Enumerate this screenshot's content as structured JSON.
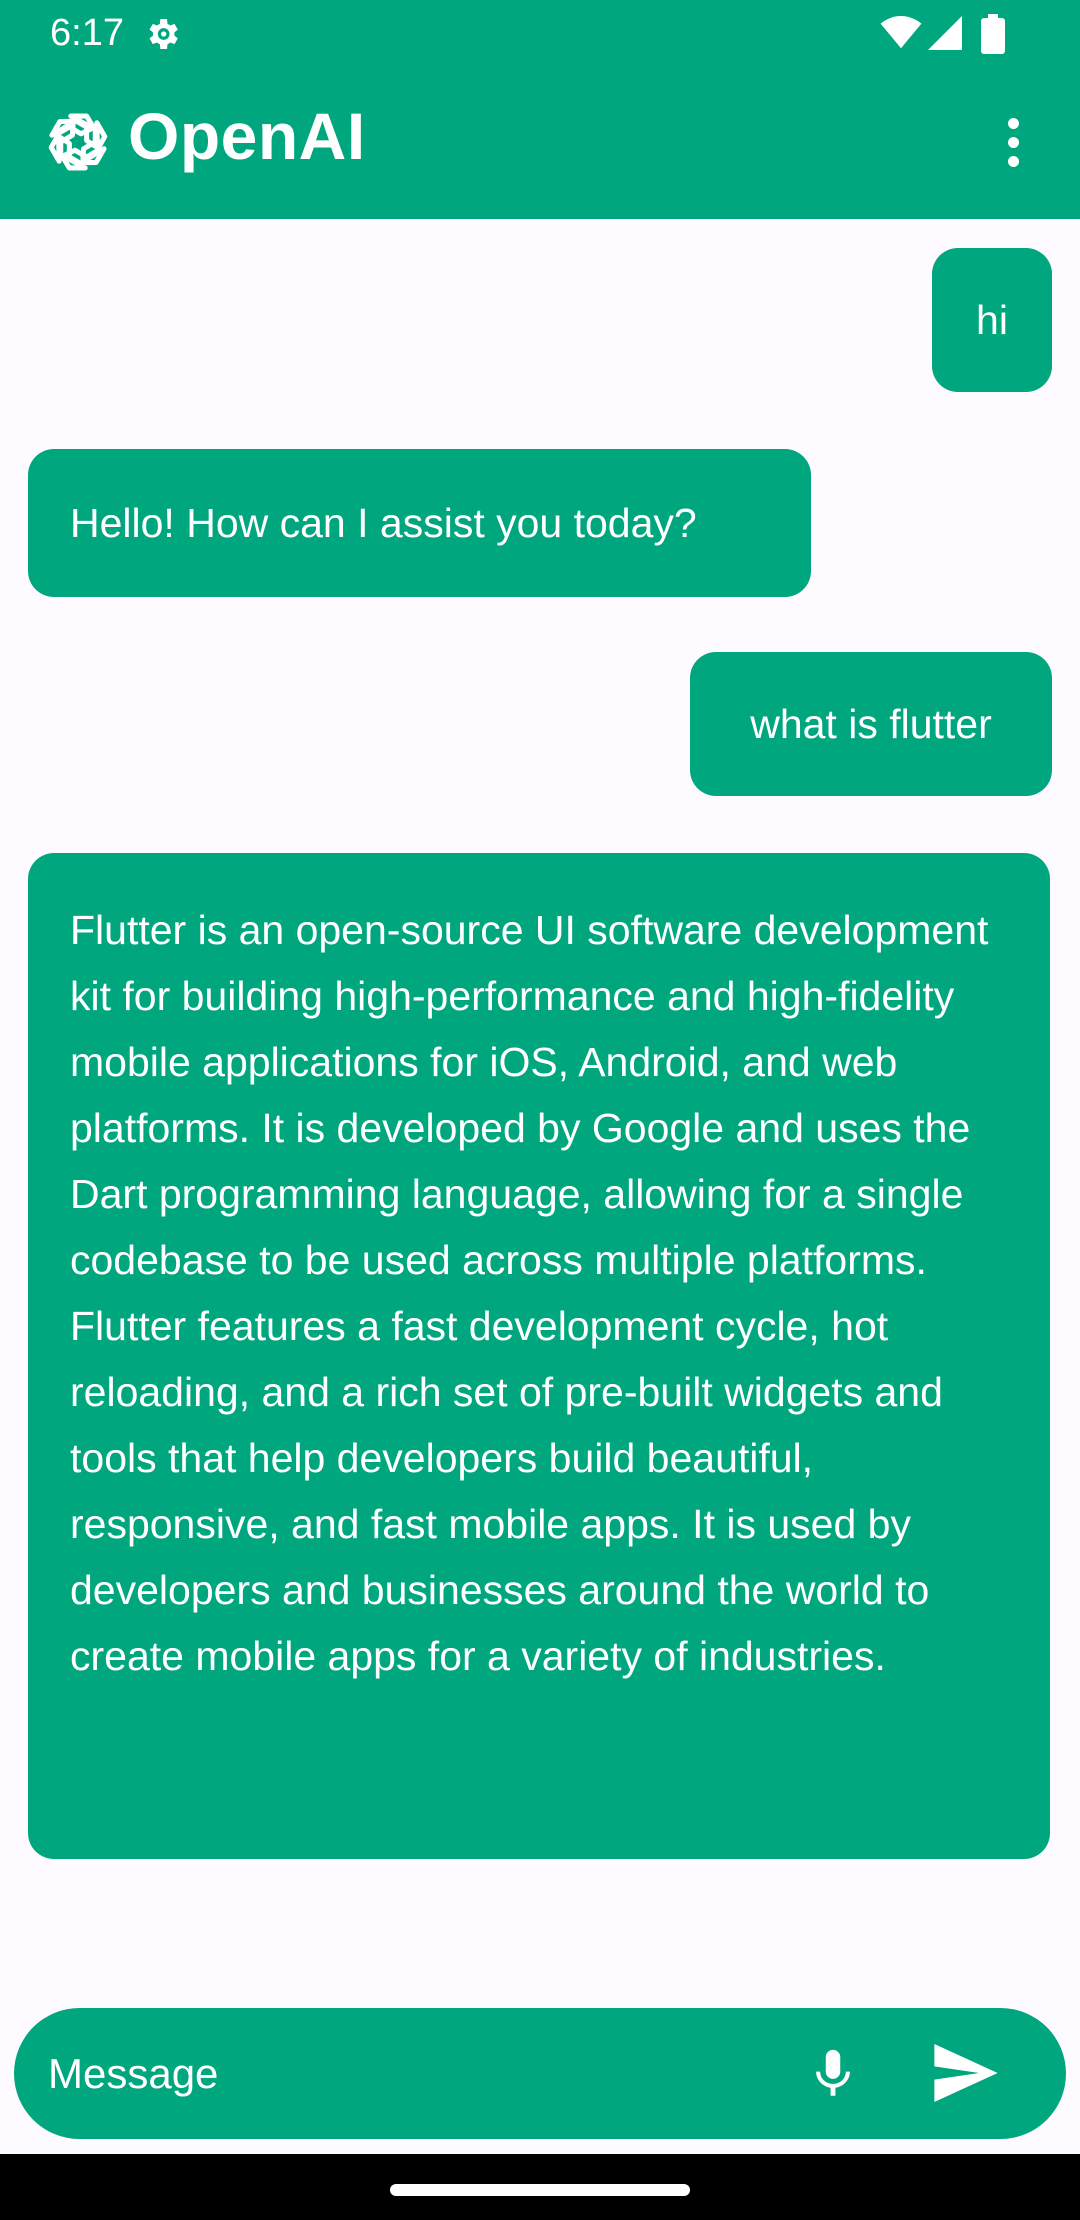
{
  "status_bar": {
    "time": "6:17",
    "icons": [
      "gear-icon",
      "wifi-icon",
      "signal-icon",
      "battery-icon"
    ]
  },
  "app_bar": {
    "title": "OpenAI",
    "logo_icon": "openai-logo-icon",
    "menu_icon": "more-vert-icon"
  },
  "messages": [
    {
      "role": "user",
      "text": "hi"
    },
    {
      "role": "assistant",
      "text": "Hello! How can I assist you today?"
    },
    {
      "role": "user",
      "text": "what is flutter"
    },
    {
      "role": "assistant",
      "text": "Flutter is an open-source UI software development kit for building high-performance and high-fidelity mobile applications for iOS, Android, and web platforms. It is developed by Google and uses the Dart programming language, allowing for a single codebase to be used across multiple platforms. Flutter features a fast development cycle, hot reloading, and a rich set of pre-built widgets and tools that help developers build beautiful, responsive, and fast mobile apps. It is used by developers and businesses around the world to create mobile apps for a variety of industries."
    }
  ],
  "composer": {
    "placeholder": "Message",
    "mic_icon": "microphone-icon",
    "send_icon": "send-icon"
  },
  "colors": {
    "accent": "#00a67e",
    "background": "#fdfbff",
    "on_accent": "#ffffff",
    "nav_bar": "#000000"
  }
}
